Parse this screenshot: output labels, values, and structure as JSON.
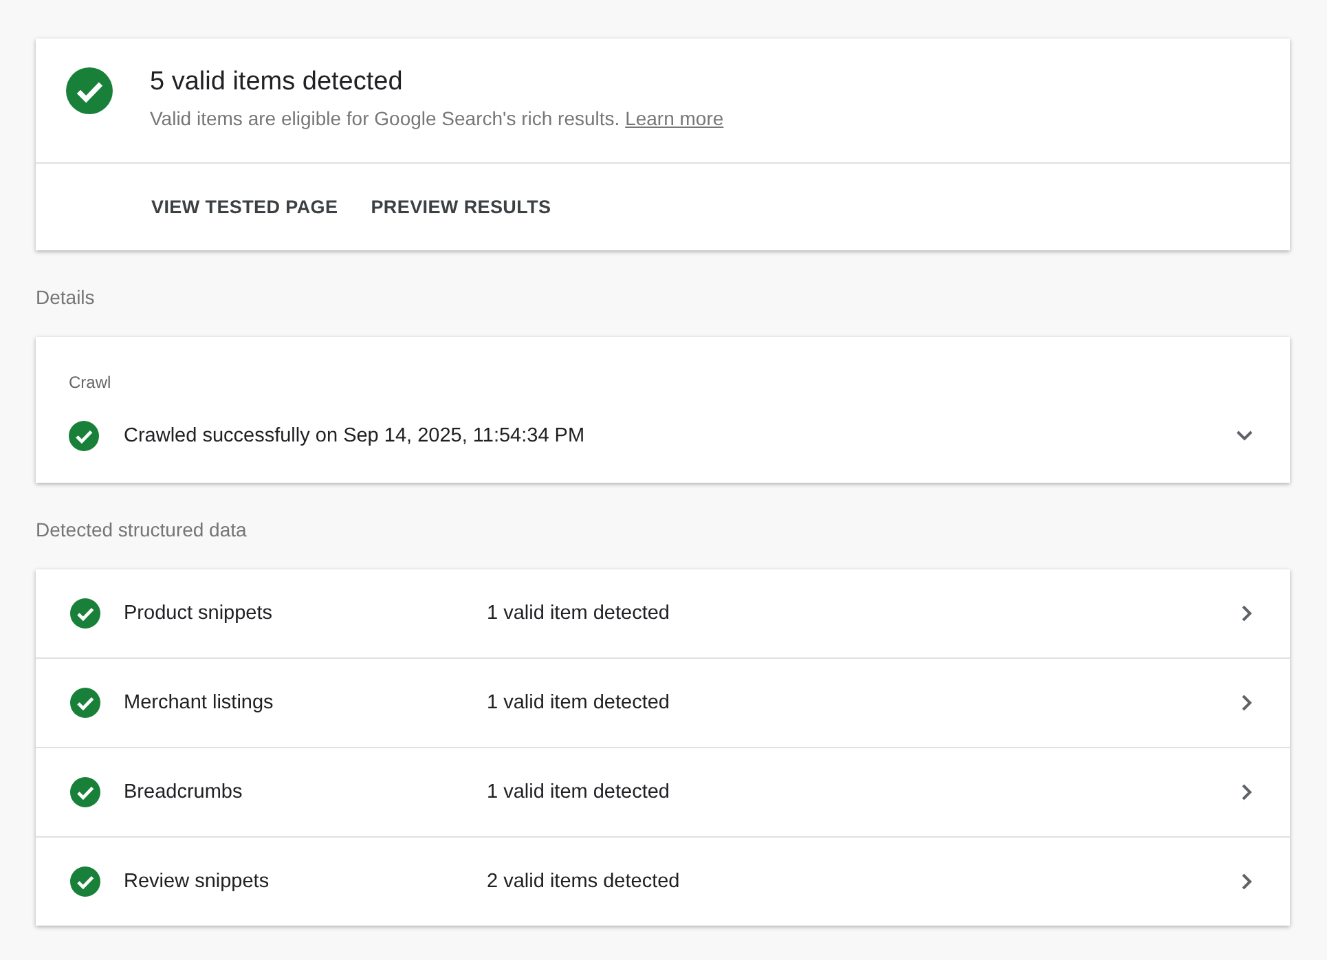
{
  "summary": {
    "kind": "valid",
    "title": "5 valid items detected",
    "description": "Valid items are eligible for Google Search's rich results.",
    "link": "Learn more",
    "actions": [
      "VIEW TESTED PAGE",
      "PREVIEW RESULTS"
    ]
  },
  "details": {
    "heading": "Details",
    "crawl": {
      "label": "Crawl",
      "kind": "valid",
      "text": "Crawled successfully on Sep 14, 2025, 11:54:34 PM",
      "expanded": false
    }
  },
  "structured_data": {
    "heading": "Detected structured data",
    "items": [
      {
        "kind": "valid",
        "name": "Product snippets",
        "result": "1 valid item detected"
      },
      {
        "kind": "valid",
        "name": "Merchant listings",
        "result": "1 valid item detected"
      },
      {
        "kind": "valid",
        "name": "Breadcrumbs",
        "result": "1 valid item detected"
      },
      {
        "kind": "valid",
        "name": "Review snippets",
        "result": "2 valid items detected"
      }
    ]
  }
}
